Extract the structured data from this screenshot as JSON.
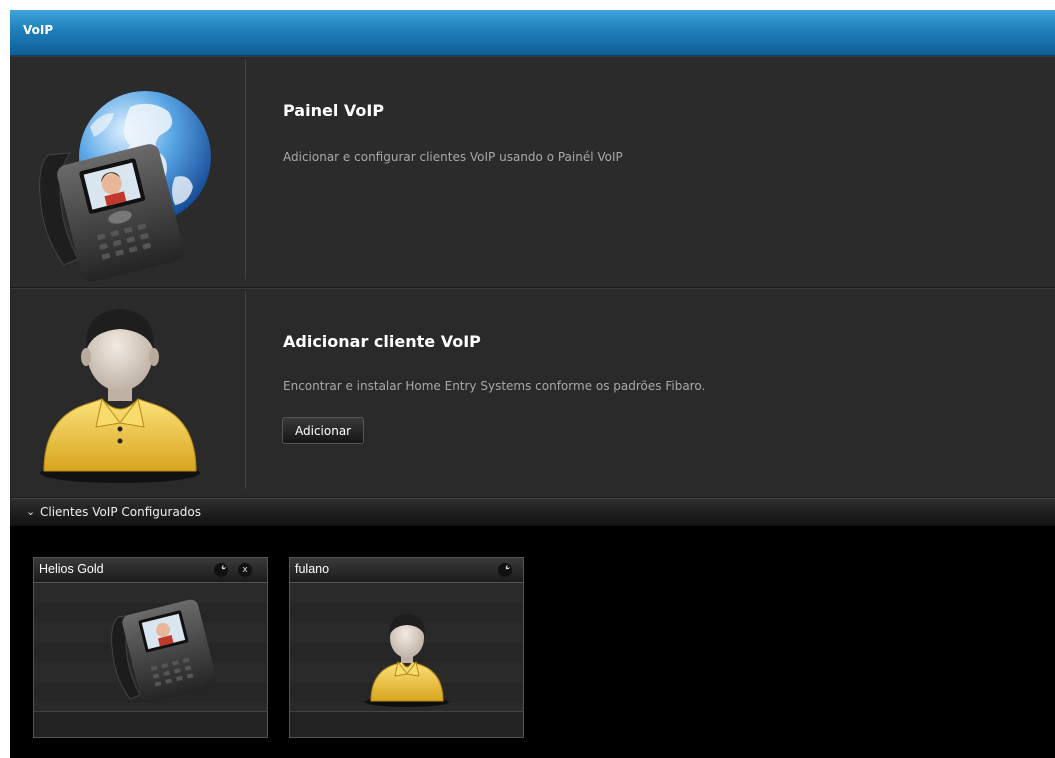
{
  "window": {
    "title": "VoIP"
  },
  "panel_voip": {
    "title": "Painel VoIP",
    "description": "Adicionar e configurar clientes VoIP usando o Painél VoIP"
  },
  "panel_add": {
    "title": "Adicionar cliente VoIP",
    "description": "Encontrar e instalar Home Entry Systems conforme os padrões Fibaro.",
    "button_label": "Adicionar"
  },
  "clients_section": {
    "label": "Clientes VoIP Configurados",
    "cards": [
      {
        "name": "Helios Gold",
        "icon": "video-phone-icon",
        "actions": [
          "wrench-icon",
          "close-icon"
        ],
        "close_label": "x"
      },
      {
        "name": "fulano",
        "icon": "user-avatar-icon",
        "actions": [
          "wrench-icon"
        ]
      }
    ]
  },
  "colors": {
    "titlebar": "#1f7fba",
    "background": "#000000",
    "panel": "#2b2b2b",
    "user_shirt": "#f3d35a"
  }
}
